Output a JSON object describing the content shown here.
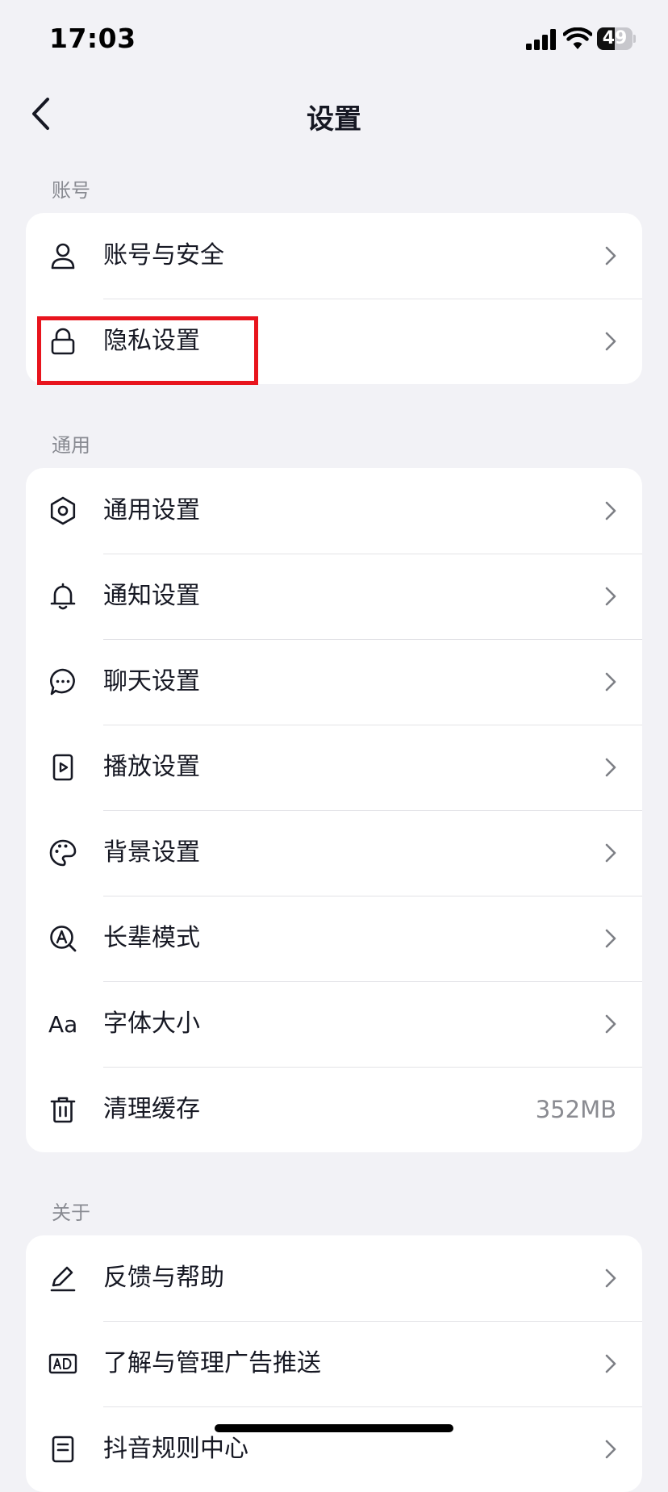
{
  "status_bar": {
    "time": "17:03",
    "battery_level": "49"
  },
  "header": {
    "title": "设置"
  },
  "sections": {
    "account": {
      "label": "账号",
      "items": [
        {
          "label": "账号与安全",
          "icon": "person-icon"
        },
        {
          "label": "隐私设置",
          "icon": "lock-icon"
        }
      ]
    },
    "general": {
      "label": "通用",
      "items": [
        {
          "label": "通用设置",
          "icon": "gear-icon"
        },
        {
          "label": "通知设置",
          "icon": "bell-icon"
        },
        {
          "label": "聊天设置",
          "icon": "chat-bubble-icon"
        },
        {
          "label": "播放设置",
          "icon": "play-icon"
        },
        {
          "label": "背景设置",
          "icon": "palette-icon"
        },
        {
          "label": "长辈模式",
          "icon": "elder-mode-icon"
        },
        {
          "label": "字体大小",
          "icon": "font-size-icon",
          "icon_text": "Aa"
        },
        {
          "label": "清理缓存",
          "icon": "trash-icon",
          "value": "352MB"
        }
      ]
    },
    "about": {
      "label": "关于",
      "items": [
        {
          "label": "反馈与帮助",
          "icon": "pen-icon"
        },
        {
          "label": "了解与管理广告推送",
          "icon": "ad-icon"
        },
        {
          "label": "抖音规则中心",
          "icon": "document-icon"
        }
      ]
    }
  },
  "colors": {
    "background": "#f2f2f6",
    "card": "#ffffff",
    "text_primary": "#161823",
    "text_secondary": "#888a91",
    "highlight": "#e8141d"
  }
}
